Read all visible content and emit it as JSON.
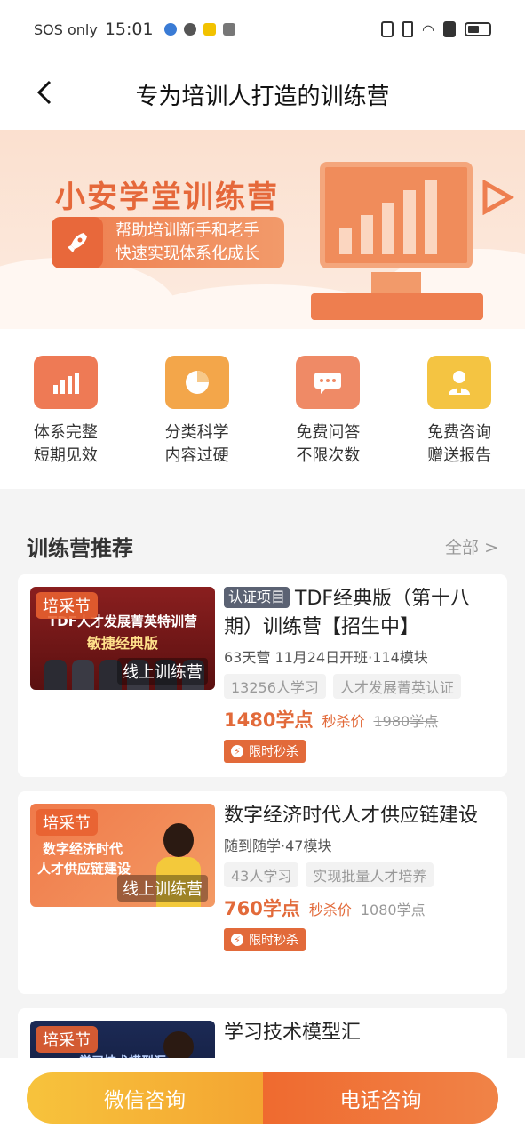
{
  "status_bar": {
    "carrier": "SOS only",
    "time": "15:01"
  },
  "nav": {
    "title": "专为培训人打造的训练营"
  },
  "banner": {
    "title": "小安学堂训练营",
    "subtitle_line1": "帮助培训新手和老手",
    "subtitle_line2": "快速实现体系化成长"
  },
  "features": [
    {
      "line1": "体系完整",
      "line2": "短期见效",
      "icon": "bar-chart-icon",
      "color": "#ee7a55"
    },
    {
      "line1": "分类科学",
      "line2": "内容过硬",
      "icon": "pie-chart-icon",
      "color": "#f3a64a"
    },
    {
      "line1": "免费问答",
      "line2": "不限次数",
      "icon": "chat-icon",
      "color": "#ef8a66"
    },
    {
      "line1": "免费咨询",
      "line2": "赠送报告",
      "icon": "consultant-icon",
      "color": "#f4c442"
    }
  ],
  "section": {
    "title": "训练营推荐",
    "see_all": "全部 >"
  },
  "courses": [
    {
      "badge": "培采节",
      "thumb_line1": "TDF人才发展菁英特训营",
      "thumb_line2": "敏捷经典版",
      "thumb_tag": "线上训练营",
      "cert": "认证项目",
      "title": "TDF经典版（第十八期）训练营【招生中】",
      "meta": "63天营 11月24日开班·114模块",
      "tags": [
        "13256人学习",
        "人才发展菁英认证"
      ],
      "price": "1480学点",
      "price_label": "秒杀价",
      "price_old": "1980学点",
      "flash": "限时秒杀"
    },
    {
      "badge": "培采节",
      "thumb_line1": "数字经济时代",
      "thumb_line2": "人才供应链建设",
      "thumb_tag": "线上训练营",
      "title": "数字经济时代人才供应链建设",
      "meta": "随到随学·47模块",
      "tags": [
        "43人学习",
        "实现批量人才培养"
      ],
      "price": "760学点",
      "price_label": "秒杀价",
      "price_old": "1080学点",
      "flash": "限时秒杀"
    },
    {
      "badge": "培采节",
      "thumb_line1": "学习技术模型汇",
      "title": "学习技术模型汇"
    }
  ],
  "bottom": {
    "wechat": "微信咨询",
    "phone": "电话咨询"
  }
}
